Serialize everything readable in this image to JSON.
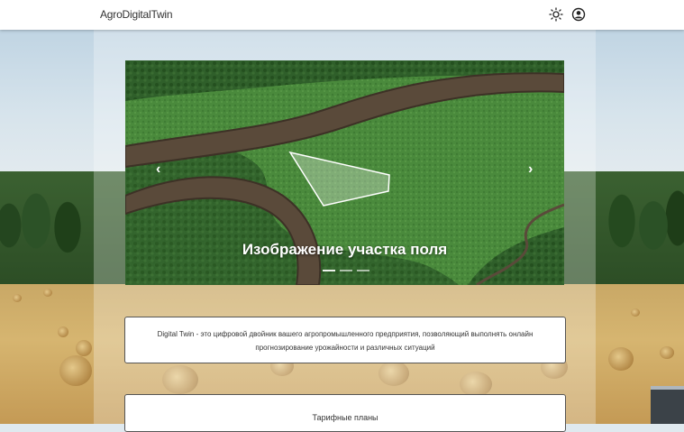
{
  "header": {
    "brand": "AgroDigitalTwin",
    "theme_icon": "sun-icon",
    "account_icon": "user-circle-icon"
  },
  "carousel": {
    "caption": "Изображение участка поля",
    "slide_count": 3,
    "active_index": 0,
    "prev_icon": "chevron-left-icon",
    "next_icon": "chevron-right-icon"
  },
  "info": {
    "text": "Digital Twin - это цифровой двойник вашего агропромышленного предприятия, позволяющий выполнять онлайн прогнозирование урожайности и различных ситуаций"
  },
  "plans": {
    "title": "Тарифные планы"
  }
}
